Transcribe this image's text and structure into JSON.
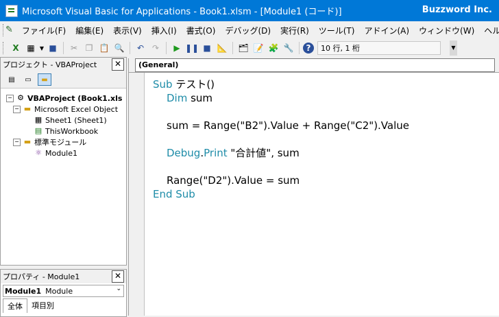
{
  "window": {
    "title": "Microsoft Visual Basic for Applications - Book1.xlsm - [Module1 (コード)]",
    "brand": "Buzzword Inc."
  },
  "menu": [
    "ファイル(F)",
    "編集(E)",
    "表示(V)",
    "挿入(I)",
    "書式(O)",
    "デバッグ(D)",
    "実行(R)",
    "ツール(T)",
    "アドイン(A)",
    "ウィンドウ(W)",
    "ヘルプ(H)"
  ],
  "toolbar": {
    "status": "10 行, 1 桁",
    "icons": [
      "excel-icon",
      "insert-userform-icon",
      "save-icon",
      "cut-icon",
      "copy-icon",
      "paste-icon",
      "find-icon",
      "undo-icon",
      "redo-icon",
      "run-icon",
      "break-icon",
      "reset-icon",
      "design-mode-icon",
      "project-explorer-icon",
      "properties-icon",
      "object-browser-icon",
      "toolbox-icon",
      "help-icon"
    ]
  },
  "project": {
    "title": "プロジェクト - VBAProject",
    "root": "VBAProject (Book1.xls",
    "folder_objects": "Microsoft Excel Object",
    "sheet1": "Sheet1 (Sheet1)",
    "thisworkbook": "ThisWorkbook",
    "folder_modules": "標準モジュール",
    "module1": "Module1"
  },
  "properties": {
    "title": "プロパティ - Module1",
    "select_bold": "Module1",
    "select_type": "Module",
    "tab_all": "全体",
    "tab_category": "項目別"
  },
  "code": {
    "object_combo": "(General)",
    "line1_kw": "Sub",
    "line1_rest": " テスト()",
    "line2_kw": "Dim",
    "line2_rest": " sum",
    "line3": "sum = Range(\"B2\").Value + Range(\"C2\").Value",
    "line4_kw1": "Debug",
    "line4_dot": ".",
    "line4_kw2": "Print",
    "line4_rest": " \"合計値\", sum",
    "line5": "Range(\"D2\").Value = sum",
    "line6": "End Sub"
  }
}
